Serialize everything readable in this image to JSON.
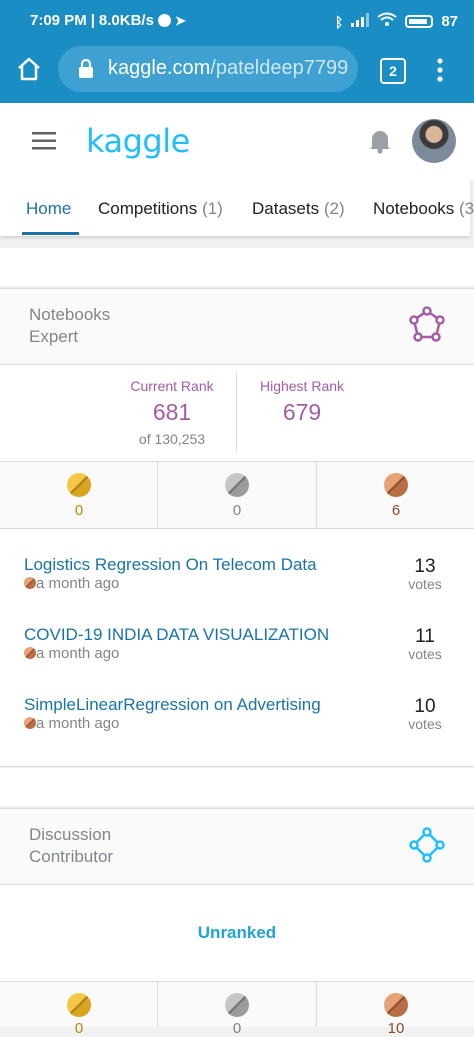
{
  "status_bar": {
    "time": "7:09 PM",
    "speed": "8.0KB/s",
    "battery": "87"
  },
  "browser": {
    "url_domain": "kaggle.com",
    "url_path": "/pateldeep7799",
    "tab_count": "2"
  },
  "header": {
    "logo": "kaggle"
  },
  "tabs": [
    {
      "label": "Home",
      "count": ""
    },
    {
      "label": "Competitions",
      "count": "(1)"
    },
    {
      "label": "Datasets",
      "count": "(2)"
    },
    {
      "label": "Notebooks",
      "count": "(3"
    }
  ],
  "notebooks_section": {
    "tier_line1": "Notebooks",
    "tier_line2": "Expert",
    "current_rank_label": "Current Rank",
    "current_rank": "681",
    "current_rank_of": "of 130,253",
    "highest_rank_label": "Highest Rank",
    "highest_rank": "679",
    "medals": {
      "gold": "0",
      "silver": "0",
      "bronze": "6"
    },
    "items": [
      {
        "title": "Logistics Regression On Telecom Data",
        "time": "a month ago",
        "votes": "13",
        "votes_label": "votes"
      },
      {
        "title": "COVID-19 INDIA DATA VISUALIZATION",
        "time": "a month ago",
        "votes": "11",
        "votes_label": "votes"
      },
      {
        "title": "SimpleLinearRegression on Advertising",
        "time": "a month ago",
        "votes": "10",
        "votes_label": "votes"
      }
    ]
  },
  "discussion_section": {
    "tier_line1": "Discussion",
    "tier_line2": "Contributor",
    "rank_text": "Unranked",
    "medals": {
      "gold": "0",
      "silver": "0",
      "bronze": "10"
    }
  },
  "colors": {
    "browser_bar": "#1a8dc4",
    "kaggle_blue": "#20beff",
    "rank_purple": "#a35da6",
    "link_blue": "#1a73a8",
    "gold": "#b8860b",
    "bronze": "#8a4b2b"
  }
}
